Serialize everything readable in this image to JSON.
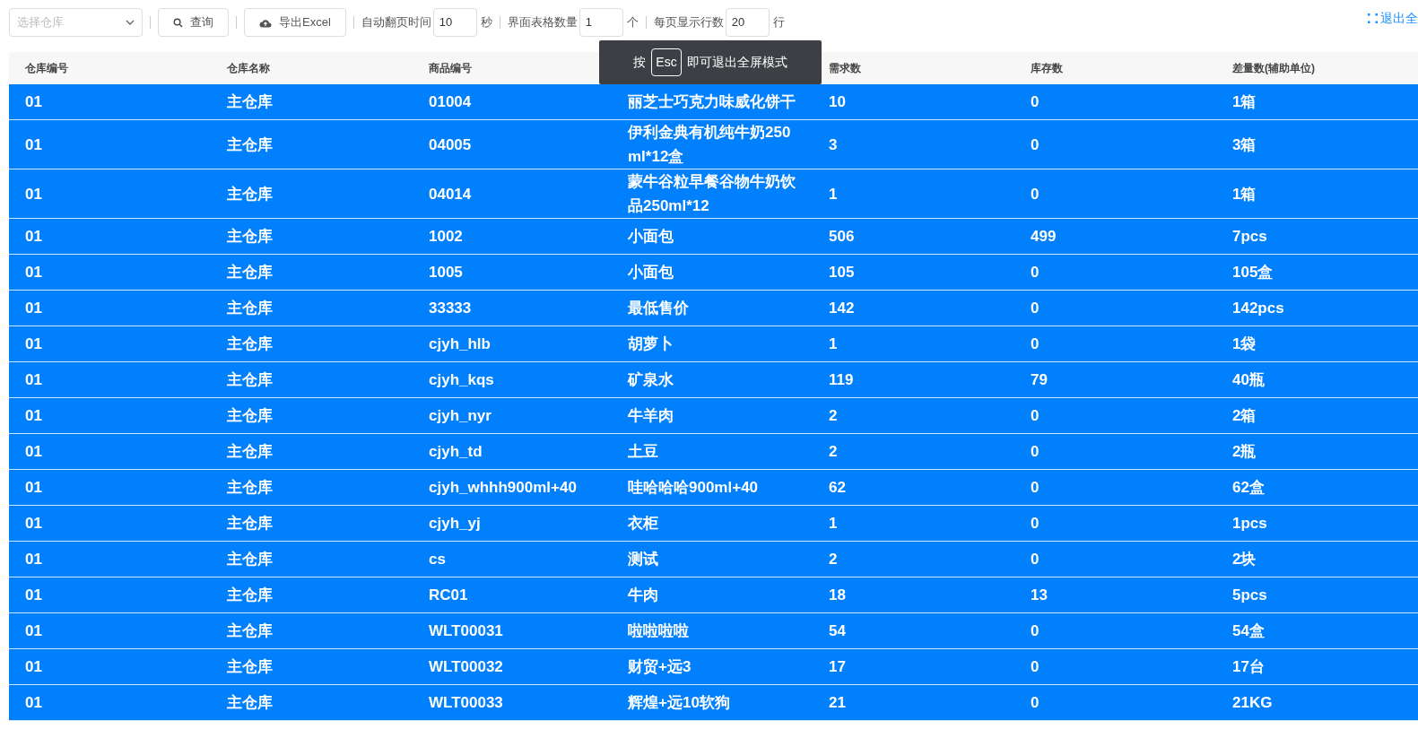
{
  "toolbar": {
    "warehouse_select": {
      "placeholder": "选择仓库"
    },
    "query_button": "查询",
    "export_button": "导出Excel",
    "fields": [
      {
        "label": "自动翻页时间",
        "value": "10",
        "unit": "秒"
      },
      {
        "label": "界面表格数量",
        "value": "1",
        "unit": "个"
      },
      {
        "label": "每页显示行数",
        "value": "20",
        "unit": "行"
      }
    ],
    "exit_fullscreen_link": "退出全"
  },
  "table": {
    "columns": [
      "仓库编号",
      "仓库名称",
      "商品编号",
      null,
      "需求数",
      "库存数",
      "差量数(辅助单位)"
    ],
    "rows": [
      [
        "01",
        "主仓库",
        "01004",
        "丽芝士巧克力味威化饼干",
        "10",
        "0",
        "1箱"
      ],
      [
        "01",
        "主仓库",
        "04005",
        "伊利金典有机纯牛奶250ml*12盒",
        "3",
        "0",
        "3箱"
      ],
      [
        "01",
        "主仓库",
        "04014",
        "蒙牛谷粒早餐谷物牛奶饮品250ml*12",
        "1",
        "0",
        "1箱"
      ],
      [
        "01",
        "主仓库",
        "1002",
        "小面包",
        "506",
        "499",
        "7pcs"
      ],
      [
        "01",
        "主仓库",
        "1005",
        "小面包",
        "105",
        "0",
        "105盒"
      ],
      [
        "01",
        "主仓库",
        "33333",
        "最低售价",
        "142",
        "0",
        "142pcs"
      ],
      [
        "01",
        "主仓库",
        "cjyh_hlb",
        "胡萝卜",
        "1",
        "0",
        "1袋"
      ],
      [
        "01",
        "主仓库",
        "cjyh_kqs",
        "矿泉水",
        "119",
        "79",
        "40瓶"
      ],
      [
        "01",
        "主仓库",
        "cjyh_nyr",
        "牛羊肉",
        "2",
        "0",
        "2箱"
      ],
      [
        "01",
        "主仓库",
        "cjyh_td",
        "土豆",
        "2",
        "0",
        "2瓶"
      ],
      [
        "01",
        "主仓库",
        "cjyh_whhh900ml+40",
        "哇哈哈哈900ml+40",
        "62",
        "0",
        "62盒"
      ],
      [
        "01",
        "主仓库",
        "cjyh_yj",
        "衣柜",
        "1",
        "0",
        "1pcs"
      ],
      [
        "01",
        "主仓库",
        "cs",
        "测试",
        "2",
        "0",
        "2块"
      ],
      [
        "01",
        "主仓库",
        "RC01",
        "牛肉",
        "18",
        "13",
        "5pcs"
      ],
      [
        "01",
        "主仓库",
        "WLT00031",
        "啦啦啦啦",
        "54",
        "0",
        "54盒"
      ],
      [
        "01",
        "主仓库",
        "WLT00032",
        "财贸+远3",
        "17",
        "0",
        "17台"
      ],
      [
        "01",
        "主仓库",
        "WLT00033",
        "辉煌+远10软狗",
        "21",
        "0",
        "21KG"
      ]
    ]
  },
  "fullscreen_notice": {
    "prefix": "按",
    "key": "Esc",
    "suffix": "即可退出全屏模式"
  }
}
